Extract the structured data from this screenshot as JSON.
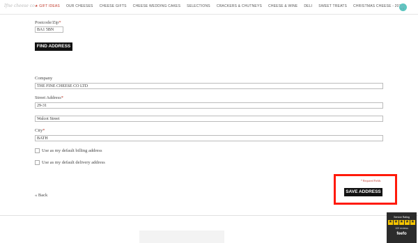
{
  "nav": {
    "logo": "Ifne cheese co.",
    "items": [
      {
        "label": "★ GIFT IDEAS",
        "active": true
      },
      {
        "label": "OUR CHEESES",
        "active": false
      },
      {
        "label": "CHEESE GIFTS",
        "active": false
      },
      {
        "label": "CHEESE WEDDING CAKES",
        "active": false
      },
      {
        "label": "SELECTIONS",
        "active": false
      },
      {
        "label": "CRACKERS & CHUTNEYS",
        "active": false
      },
      {
        "label": "CHEESE & WINE",
        "active": false
      },
      {
        "label": "DELI",
        "active": false
      },
      {
        "label": "SWEET TREATS",
        "active": false
      },
      {
        "label": "CHRISTMAS CHEESE - 2016",
        "active": false
      }
    ],
    "cart_icon": "cart-icon"
  },
  "form": {
    "postcode_label": "Postcode/Zip",
    "postcode_value": "BA1 5BN",
    "find_address_label": "FIND ADDRESS",
    "company_label": "Company",
    "company_value": "THE FINE CHEESE CO LTD",
    "street_label": "Street Address",
    "street1_value": "29-31",
    "street2_value": "Walcot Street",
    "city_label": "City",
    "city_value": "BATH",
    "default_billing_label": "Use as my default billing address",
    "default_delivery_label": "Use as my default delivery address",
    "required_star": "*",
    "required_note": "* Required Fields",
    "back_label": "« Back",
    "save_label": "SAVE ADDRESS"
  },
  "feefo": {
    "title": "Service Rating",
    "reviews": "109 reviews",
    "brand": "feefo"
  },
  "colors": {
    "accent": "#5cc6c0",
    "required": "#c0392b",
    "highlight": "#ff1a0a"
  }
}
